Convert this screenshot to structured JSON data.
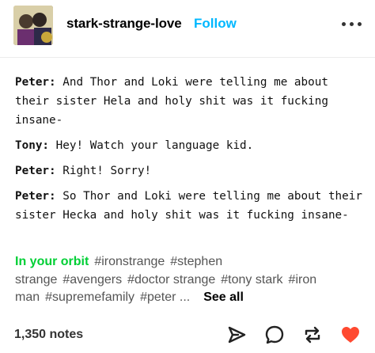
{
  "post": {
    "author": "stark-strange-love",
    "follow_label": "Follow",
    "paragraphs": [
      {
        "speaker": "Peter:",
        "text": " And Thor and Loki were telling me about their sister Hela and holy shit was it fucking insane-"
      },
      {
        "speaker": "Tony:",
        "text": " Hey! Watch your language kid."
      },
      {
        "speaker": "Peter:",
        "text": " Right! Sorry!"
      },
      {
        "speaker": "Peter:",
        "text": " So Thor and Loki were telling me about their sister Hecka and holy shit was it fucking insane-"
      }
    ],
    "tags_header": "In your orbit",
    "tags": [
      "#ironstrange",
      "#stephen strange",
      "#avengers",
      "#doctor strange",
      "#tony stark",
      "#iron man",
      "#supremefamily",
      "#peter ..."
    ],
    "see_all": "See all",
    "notes": "1,350 notes"
  },
  "icons": {
    "more": "more-horizontal-icon",
    "share": "share-send-icon",
    "reply": "reply-bubble-icon",
    "reblog": "reblog-icon",
    "like": "heart-icon"
  },
  "colors": {
    "follow": "#00b8ff",
    "orbit": "#00cf35",
    "like": "#ff4930"
  }
}
